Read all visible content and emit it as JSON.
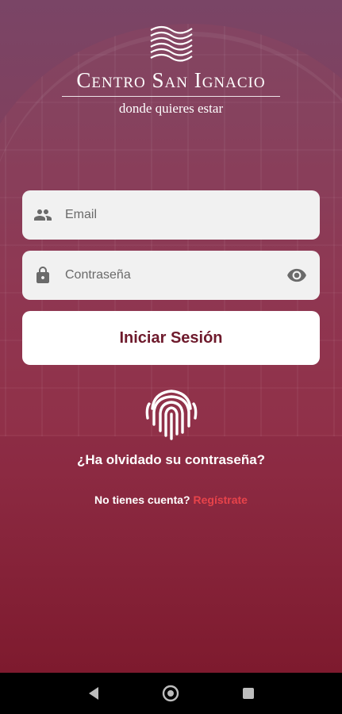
{
  "brand": {
    "name": "Centro San Ignacio",
    "tagline": "donde quieres estar"
  },
  "login": {
    "email_placeholder": "Email",
    "password_placeholder": "Contraseña",
    "submit_label": "Iniciar Sesión",
    "forgot_label": "¿Ha olvidado su contraseña?",
    "signup_prompt": "No tienes cuenta?",
    "signup_link": "Regístrate"
  },
  "icons": {
    "email": "people-icon",
    "password": "lock-icon",
    "visibility": "eye-icon",
    "biometric": "fingerprint-icon"
  },
  "colors": {
    "accent": "#6e1a2c",
    "link": "#e8434a",
    "field_bg": "#f1f1f1"
  }
}
